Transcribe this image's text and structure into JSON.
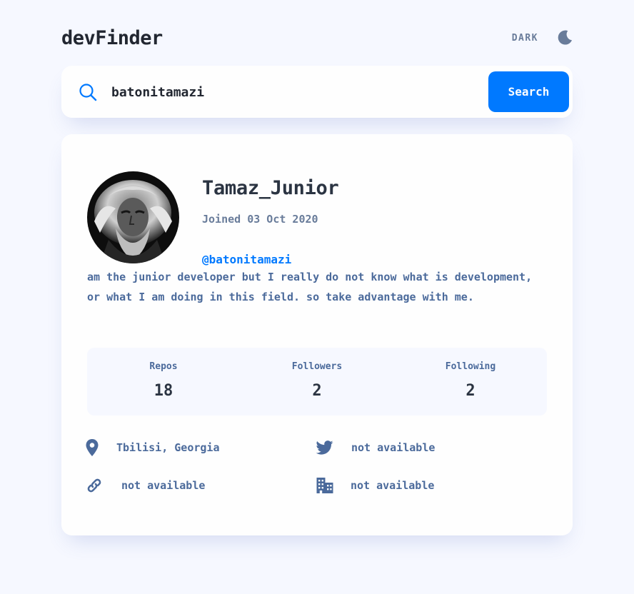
{
  "app": {
    "logo": "devFinder",
    "theme_label": "DARK",
    "colors": {
      "accent": "#0079ff",
      "background": "#f6f8ff",
      "card": "#fefefe",
      "text_dark": "#2b3442",
      "text_muted": "#4b6a9b"
    }
  },
  "search": {
    "value": "batonitamazi",
    "button_label": "Search"
  },
  "profile": {
    "name": "Tamaz_Junior",
    "joined": "Joined 03 Oct 2020",
    "login": "@batonitamazi",
    "bio": "am the junior developer but I really do not know what is development, or what I am doing in this field. so take advantage with me."
  },
  "stats": [
    {
      "label": "Repos",
      "value": "18"
    },
    {
      "label": "Followers",
      "value": "2"
    },
    {
      "label": "Following",
      "value": "2"
    }
  ],
  "links": {
    "location": {
      "icon": "location-pin-icon",
      "text": "Tbilisi, Georgia"
    },
    "twitter": {
      "icon": "twitter-icon",
      "text": "not available"
    },
    "website": {
      "icon": "link-icon",
      "text": "not available"
    },
    "company": {
      "icon": "building-icon",
      "text": "not available"
    }
  }
}
